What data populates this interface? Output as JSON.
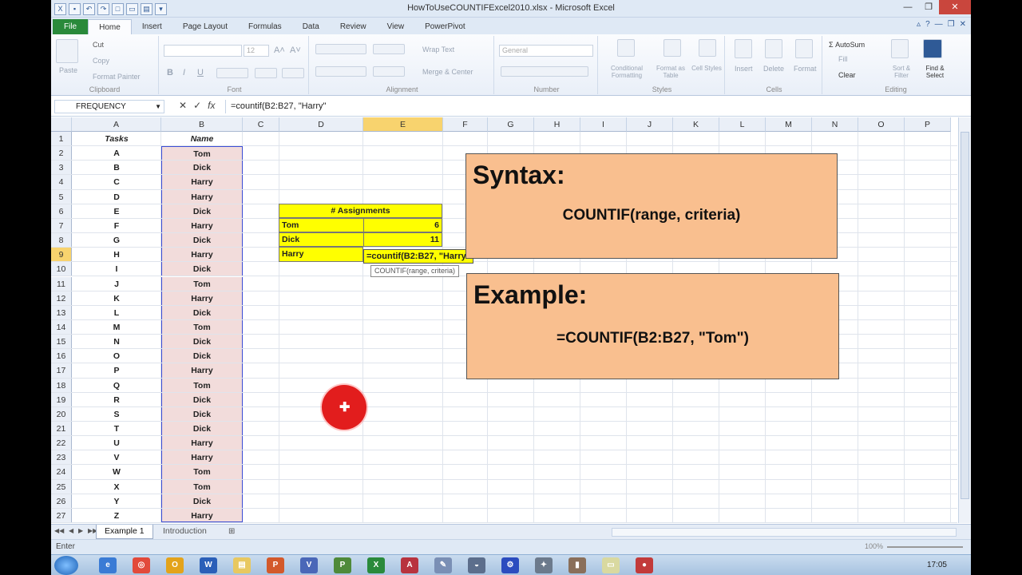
{
  "window": {
    "title": "HowToUseCOUNTIFExcel2010.xlsx - Microsoft Excel"
  },
  "tabs": [
    "File",
    "Home",
    "Insert",
    "Page Layout",
    "Formulas",
    "Data",
    "Review",
    "View",
    "PowerPivot"
  ],
  "active_tab": "Home",
  "ribbon": {
    "clipboard": {
      "paste": "Paste",
      "cut": "Cut",
      "copy": "Copy",
      "format_painter": "Format Painter",
      "label": "Clipboard"
    },
    "font": {
      "size": "12",
      "bold": "B",
      "italic": "I",
      "underline": "U",
      "label": "Font"
    },
    "alignment": {
      "wrap_text": "Wrap Text",
      "merge_center": "Merge & Center",
      "label": "Alignment"
    },
    "number": {
      "format": "General",
      "label": "Number"
    },
    "styles": {
      "conditional": "Conditional Formatting",
      "format_table": "Format as Table",
      "cell_styles": "Cell Styles",
      "label": "Styles"
    },
    "cells": {
      "insert": "Insert",
      "delete": "Delete",
      "format": "Format",
      "label": "Cells"
    },
    "editing": {
      "autosum": "AutoSum",
      "fill": "Fill",
      "clear": "Clear",
      "sort_filter": "Sort & Filter",
      "find_select": "Find & Select",
      "label": "Editing"
    }
  },
  "formula_bar": {
    "name_box": "FREQUENCY",
    "fx": "fx",
    "formula": "=countif(B2:B27, \"Harry\""
  },
  "columns": [
    "A",
    "B",
    "C",
    "D",
    "E",
    "F",
    "G",
    "H",
    "I",
    "J",
    "K",
    "L",
    "M",
    "N",
    "O",
    "P"
  ],
  "selected_column": "E",
  "selected_row": "9",
  "header_row": {
    "tasks": "Tasks",
    "name": "Name"
  },
  "rows": [
    {
      "n": "1"
    },
    {
      "n": "2",
      "a": "A",
      "b": "Tom"
    },
    {
      "n": "3",
      "a": "B",
      "b": "Dick"
    },
    {
      "n": "4",
      "a": "C",
      "b": "Harry"
    },
    {
      "n": "5",
      "a": "D",
      "b": "Harry"
    },
    {
      "n": "6",
      "a": "E",
      "b": "Dick"
    },
    {
      "n": "7",
      "a": "F",
      "b": "Harry"
    },
    {
      "n": "8",
      "a": "G",
      "b": "Dick"
    },
    {
      "n": "9",
      "a": "H",
      "b": "Harry"
    },
    {
      "n": "10",
      "a": "I",
      "b": "Dick"
    },
    {
      "n": "11",
      "a": "J",
      "b": "Tom"
    },
    {
      "n": "12",
      "a": "K",
      "b": "Harry"
    },
    {
      "n": "13",
      "a": "L",
      "b": "Dick"
    },
    {
      "n": "14",
      "a": "M",
      "b": "Tom"
    },
    {
      "n": "15",
      "a": "N",
      "b": "Dick"
    },
    {
      "n": "16",
      "a": "O",
      "b": "Dick"
    },
    {
      "n": "17",
      "a": "P",
      "b": "Harry"
    },
    {
      "n": "18",
      "a": "Q",
      "b": "Tom"
    },
    {
      "n": "19",
      "a": "R",
      "b": "Dick"
    },
    {
      "n": "20",
      "a": "S",
      "b": "Dick"
    },
    {
      "n": "21",
      "a": "T",
      "b": "Dick"
    },
    {
      "n": "22",
      "a": "U",
      "b": "Harry"
    },
    {
      "n": "23",
      "a": "V",
      "b": "Harry"
    },
    {
      "n": "24",
      "a": "W",
      "b": "Tom"
    },
    {
      "n": "25",
      "a": "X",
      "b": "Tom"
    },
    {
      "n": "26",
      "a": "Y",
      "b": "Dick"
    },
    {
      "n": "27",
      "a": "Z",
      "b": "Harry"
    }
  ],
  "assignments": {
    "title": "# Assignments",
    "rows": [
      {
        "name": "Tom",
        "value": "6"
      },
      {
        "name": "Dick",
        "value": "11"
      },
      {
        "name": "Harry",
        "value": ""
      }
    ]
  },
  "editing_cell": "=countif(B2:B27, \"Harry\"",
  "tooltip": "COUNTIF(range, criteria)",
  "syntax_box": {
    "title": "Syntax:",
    "formula": "COUNTIF(range, criteria)"
  },
  "example_box": {
    "title": "Example:",
    "formula": "=COUNTIF(B2:B27, \"Tom\")"
  },
  "sheet_tabs": [
    "Example 1",
    "Introduction"
  ],
  "active_sheet": "Example 1",
  "status": {
    "mode": "Enter",
    "zoom": "100%"
  },
  "taskbar": {
    "time": "17:05"
  },
  "colors": {
    "accent": "#2a8a3b",
    "highlight": "#ffff00",
    "pink_column": "#f2dcdb",
    "box_fill": "#f9bf8f",
    "cursor": "#e21d1d"
  }
}
